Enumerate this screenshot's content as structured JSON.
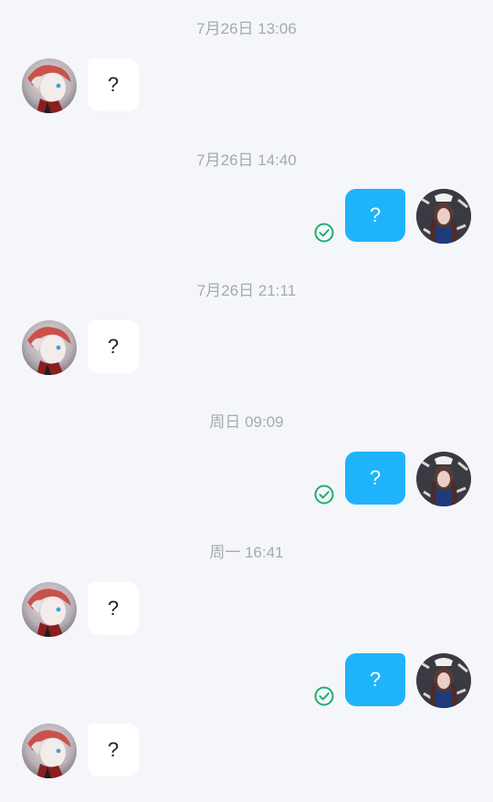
{
  "colors": {
    "background": "#f4f6fa",
    "incoming_bubble": "#ffffff",
    "outgoing_bubble": "#1fb3fb",
    "timestamp_text": "#a5a9b0",
    "read_check": "#1fae6d"
  },
  "messages": [
    {
      "timestamp": "7月26日 13:06",
      "direction": "incoming",
      "text": "?",
      "avatar": "avatar-icon"
    },
    {
      "timestamp": "7月26日 14:40",
      "direction": "outgoing",
      "text": "?",
      "status": "read-check-icon",
      "avatar": "avatar-icon"
    },
    {
      "timestamp": "7月26日 21:11",
      "direction": "incoming",
      "text": "?",
      "avatar": "avatar-icon"
    },
    {
      "timestamp": "周日 09:09",
      "direction": "outgoing",
      "text": "?",
      "status": "read-check-icon",
      "avatar": "avatar-icon"
    },
    {
      "timestamp": "周一 16:41",
      "direction": "incoming",
      "text": "?",
      "avatar": "avatar-icon"
    },
    {
      "timestamp": "",
      "direction": "outgoing",
      "text": "?",
      "status": "read-check-icon",
      "avatar": "avatar-icon"
    },
    {
      "timestamp": "",
      "direction": "incoming",
      "text": "?",
      "avatar": "avatar-icon"
    }
  ]
}
